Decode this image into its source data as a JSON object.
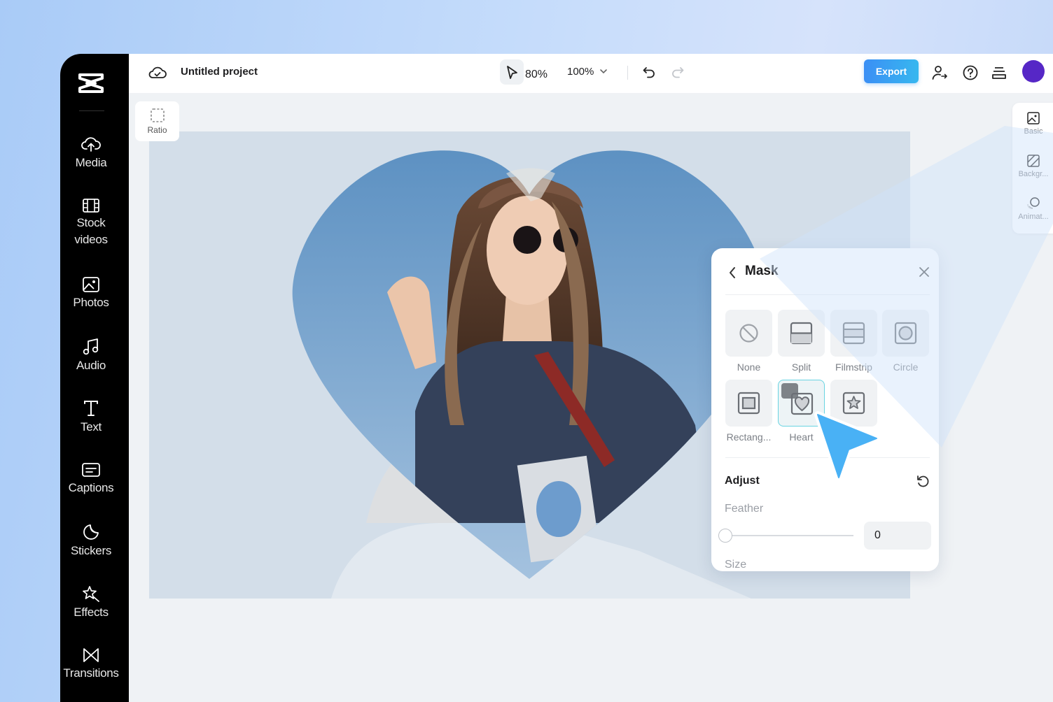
{
  "sidebar": {
    "items": [
      {
        "icon": "upload-cloud-icon",
        "label": "Media"
      },
      {
        "icon": "film-icon",
        "label": "Stock\nvideos"
      },
      {
        "icon": "image-icon",
        "label": "Photos"
      },
      {
        "icon": "music-icon",
        "label": "Audio"
      },
      {
        "icon": "text-icon",
        "label": "Text"
      },
      {
        "icon": "captions-icon",
        "label": "Captions"
      },
      {
        "icon": "sticker-icon",
        "label": "Stickers"
      },
      {
        "icon": "sparkle-icon",
        "label": "Effects"
      },
      {
        "icon": "transition-icon",
        "label": "Transitions"
      }
    ]
  },
  "topbar": {
    "project_title": "Untitled project",
    "cursor_zoom": "80%",
    "zoom_select": "100%",
    "export_label": "Export"
  },
  "canvas": {
    "ratio_label": "Ratio"
  },
  "right_rail": {
    "items": [
      {
        "icon": "basic-icon",
        "label": "Basic"
      },
      {
        "icon": "background-icon",
        "label": "Backgr..."
      },
      {
        "icon": "animation-icon",
        "label": "Animat..."
      }
    ]
  },
  "mask_panel": {
    "title": "Mask",
    "options": [
      {
        "label": "None",
        "icon": "none-icon"
      },
      {
        "label": "Split",
        "icon": "split-icon"
      },
      {
        "label": "Filmstrip",
        "icon": "filmstrip-icon"
      },
      {
        "label": "Circle",
        "icon": "circle-icon"
      },
      {
        "label": "Rectang...",
        "icon": "rectangle-icon"
      },
      {
        "label": "Heart",
        "icon": "heart-icon",
        "selected": true
      },
      {
        "label": "",
        "icon": "star-icon"
      }
    ],
    "adjust_label": "Adjust",
    "feather_label": "Feather",
    "feather_value": "0",
    "size_label": "Size"
  },
  "colors": {
    "accent": "#3b8ff5",
    "selected_border": "#69d4e2",
    "pointer": "#49b1f5",
    "avatar": "#5627c6"
  }
}
